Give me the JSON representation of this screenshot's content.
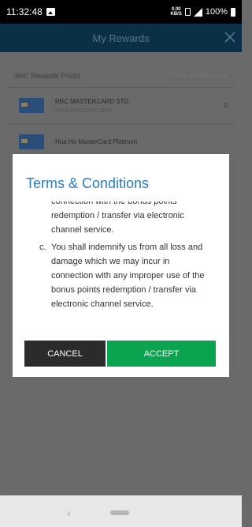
{
  "status_bar": {
    "time": "11:32:48",
    "data_speed_top": "0.00",
    "data_speed_bottom": "KB/S",
    "battery": "100%"
  },
  "header": {
    "title": "My Rewards"
  },
  "rewards": {
    "section_title": "360° Rewards Points",
    "total_label": "TOTAL POINTS 14,600",
    "cards": [
      {
        "name": "RBC MASTERCARD STD",
        "number": "5404 0050 0000 0000",
        "points": "0"
      },
      {
        "name": "Hua Ho MasterCard Platinum",
        "number": "",
        "points": ""
      }
    ]
  },
  "modal": {
    "title": "Terms & Conditions",
    "terms_continued": "connection with the bonus points redemption / transfer via electronic channel service.",
    "term_c_letter": "c.",
    "term_c_text": "You shall indemnify us from all loss and damage which we may incur in connection with any improper use of the bonus points redemption / transfer via electronic channel service.",
    "cancel_label": "CANCEL",
    "accept_label": "ACCEPT"
  },
  "colors": {
    "header_bg": "#0a3048",
    "title_blue": "#2b7ec1",
    "accept_green": "#0aa34f",
    "cancel_dark": "#2b2b2b"
  }
}
